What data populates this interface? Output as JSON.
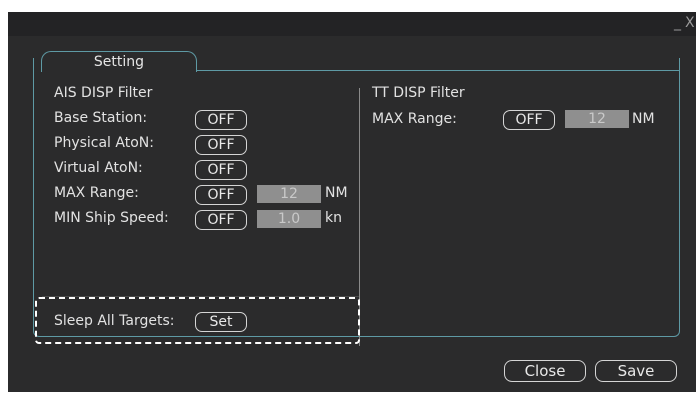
{
  "window": {
    "minimize_glyph": "_",
    "close_glyph": "X"
  },
  "tabs": [
    {
      "label": "Setting"
    }
  ],
  "ais": {
    "title": "AIS DISP Filter",
    "rows": [
      {
        "label": "Base Station:",
        "button": "OFF"
      },
      {
        "label": "Physical AtoN:",
        "button": "OFF"
      },
      {
        "label": "Virtual AtoN:",
        "button": "OFF"
      },
      {
        "label": "MAX Range:",
        "button": "OFF",
        "value": "12",
        "unit": "NM"
      },
      {
        "label": "MIN Ship Speed:",
        "button": "OFF",
        "value": "1.0",
        "unit": "kn"
      }
    ],
    "sleep": {
      "label": "Sleep All Targets:",
      "button": "Set"
    }
  },
  "tt": {
    "title": "TT DISP Filter",
    "max_range": {
      "label": "MAX Range:",
      "button": "OFF",
      "value": "12",
      "unit": "NM"
    }
  },
  "footer": {
    "close_label": "Close",
    "save_label": "Save"
  },
  "colors": {
    "accent": "#5e9aa5",
    "background": "#2b2b2c",
    "field": "#8f8f8f"
  }
}
